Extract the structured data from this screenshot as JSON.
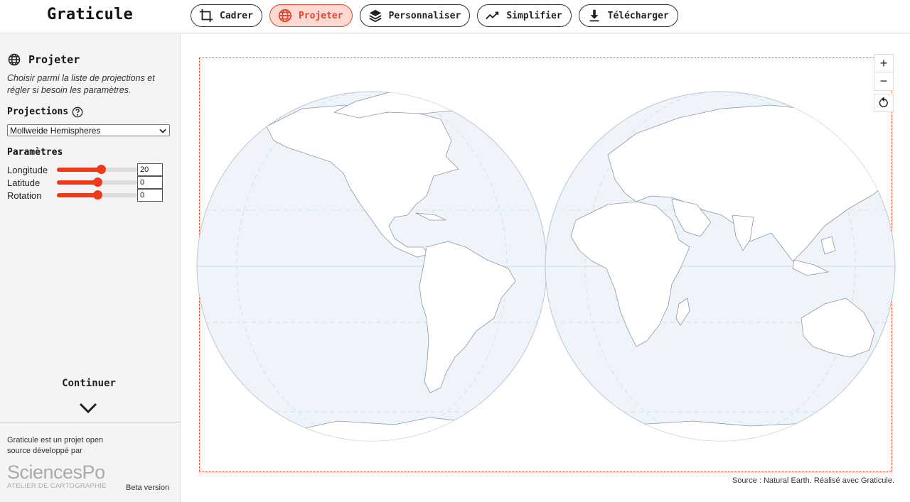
{
  "app": {
    "title": "Graticule"
  },
  "nav": {
    "items": [
      {
        "label": "Cadrer",
        "icon": "crop-icon"
      },
      {
        "label": "Projeter",
        "icon": "globe-icon",
        "active": true
      },
      {
        "label": "Personnaliser",
        "icon": "layers-icon"
      },
      {
        "label": "Simplifier",
        "icon": "line-chart-icon"
      },
      {
        "label": "Télécharger",
        "icon": "download-icon"
      }
    ]
  },
  "panel": {
    "title": "Projeter",
    "description": "Choisir parmi la liste de projections et régler si besoin les paramètres.",
    "projections_label": "Projections",
    "projection_selected": "Mollweide Hemispheres",
    "parameters_label": "Paramètres",
    "parameters": [
      {
        "label": "Longitude",
        "value": "20",
        "fraction": 0.55
      },
      {
        "label": "Latitude",
        "value": "0",
        "fraction": 0.5
      },
      {
        "label": "Rotation",
        "value": "0",
        "fraction": 0.5
      }
    ],
    "continue_label": "Continuer"
  },
  "footer": {
    "credit": "Graticule est un projet open source développé par",
    "logo_name": "SciencesPo",
    "logo_sub": "ATELIER DE CARTOGRAPHIE",
    "beta": "Beta version"
  },
  "map": {
    "source": "Source : Natural Earth. Réalisé avec Graticule.",
    "zoom_in": "+",
    "zoom_out": "−"
  },
  "colors": {
    "accent": "#e0432c",
    "ocean": "#eef4fa",
    "active_bg": "#fdd9d2"
  }
}
